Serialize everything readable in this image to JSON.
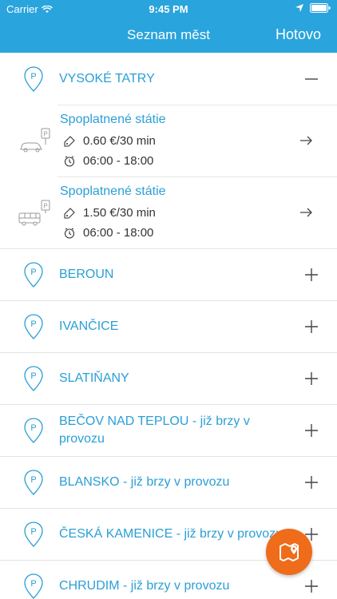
{
  "status": {
    "carrier": "Carrier",
    "time": "9:45 PM"
  },
  "nav": {
    "title": "Seznam měst",
    "done": "Hotovo"
  },
  "cities": [
    {
      "label": "VYSOKÉ TATRY",
      "expanded": true,
      "zones": [
        {
          "vehicle": "car-parking-icon",
          "name": "Spoplatnené státie",
          "price": "0.60 €/30 min",
          "hours": "06:00 - 18:00"
        },
        {
          "vehicle": "bus-parking-icon",
          "name": "Spoplatnené státie",
          "price": "1.50 €/30 min",
          "hours": "06:00 - 18:00"
        }
      ]
    },
    {
      "label": "BEROUN",
      "expanded": false
    },
    {
      "label": "IVANČICE",
      "expanded": false
    },
    {
      "label": "SLATIŇANY",
      "expanded": false
    },
    {
      "label": "BEČOV NAD TEPLOU - již brzy v provozu",
      "expanded": false
    },
    {
      "label": "BLANSKO - již brzy v provozu",
      "expanded": false
    },
    {
      "label": "ČESKÁ KAMENICE - již brzy v provozu",
      "expanded": false
    },
    {
      "label": "CHRUDIM - již brzy v provozu",
      "expanded": false
    }
  ],
  "colors": {
    "primary": "#2aa4dc",
    "accent": "#ef6c1a",
    "text": "#2a9fd6"
  },
  "fab": {
    "icon": "map-pin-icon"
  }
}
